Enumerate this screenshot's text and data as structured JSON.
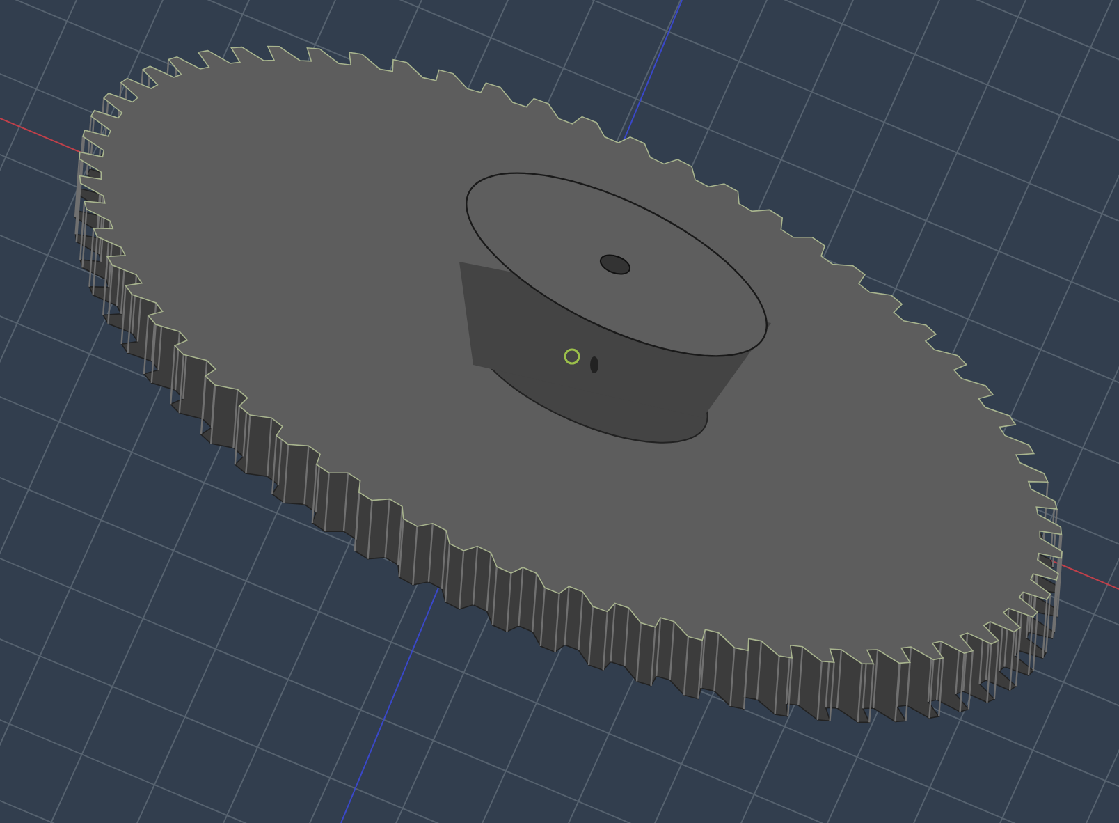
{
  "viewport": {
    "kind": "gear"
  }
}
